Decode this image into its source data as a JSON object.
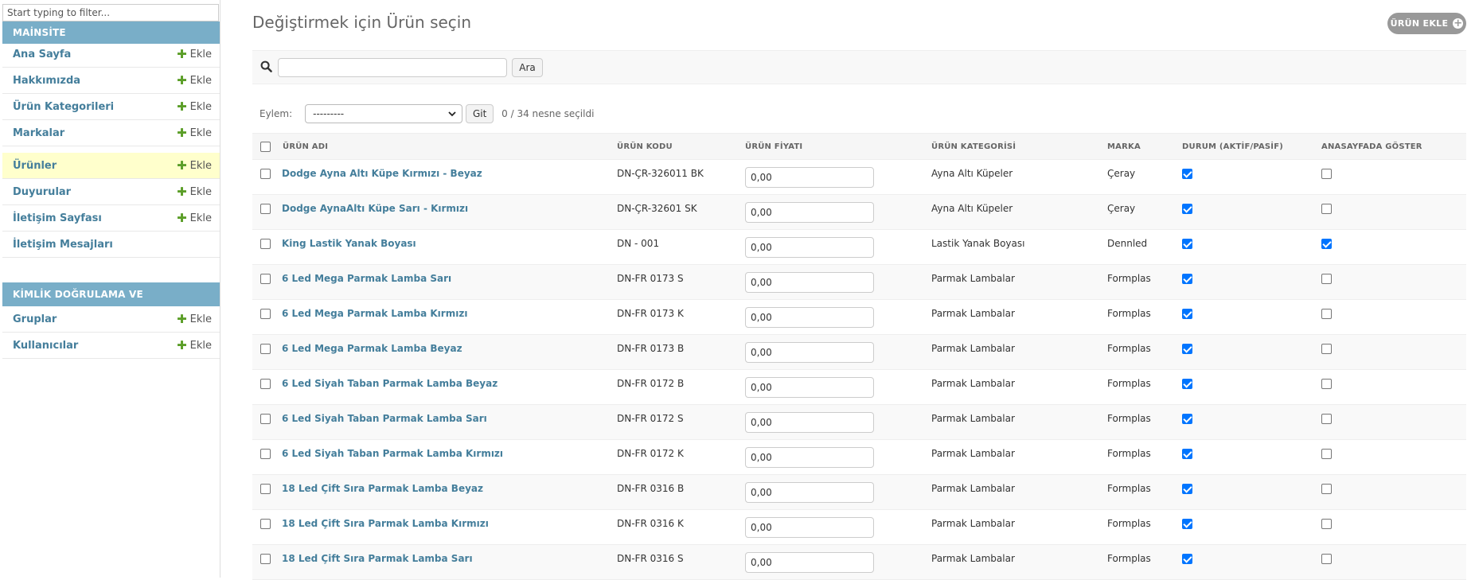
{
  "sidebar": {
    "filter_placeholder": "Start typing to filter...",
    "sections": [
      {
        "title": "MAİNSİTE",
        "items": [
          {
            "label": "Ana Sayfa",
            "add": "Ekle",
            "active": false
          },
          {
            "label": "Hakkımızda",
            "add": "Ekle",
            "active": false
          },
          {
            "label": "Ürün Kategorileri",
            "add": "Ekle",
            "active": false
          },
          {
            "label": "Markalar",
            "add": "Ekle",
            "active": false
          },
          {
            "label": "Ürünler",
            "add": "Ekle",
            "active": true
          },
          {
            "label": "Duyurular",
            "add": "Ekle",
            "active": false
          },
          {
            "label": "İletişim Sayfası",
            "add": "Ekle",
            "active": false
          },
          {
            "label": "İletişim Mesajları",
            "add": "",
            "active": false
          }
        ]
      },
      {
        "title": "KİMLİK DOĞRULAMA VE YETKİLENDİRME",
        "items": [
          {
            "label": "Gruplar",
            "add": "Ekle",
            "active": false
          },
          {
            "label": "Kullanıcılar",
            "add": "Ekle",
            "active": false
          }
        ]
      }
    ]
  },
  "main": {
    "title": "Değiştirmek için Ürün seçin",
    "add_button": "ÜRÜN EKLE",
    "search": {
      "value": "",
      "button": "Ara"
    },
    "actions": {
      "label": "Eylem:",
      "selected": "---------",
      "go": "Git",
      "counter": "0 / 34 nesne seçildi"
    },
    "columns": [
      "ÜRÜN ADI",
      "ÜRÜN KODU",
      "ÜRÜN FİYATI",
      "ÜRÜN KATEGORİSİ",
      "MARKA",
      "DURUM (AKTİF/PASİF)",
      "ANASAYFADA GÖSTER"
    ],
    "rows": [
      {
        "name": "Dodge Ayna Altı Küpe Kırmızı - Beyaz",
        "code": "DN-ÇR-326011 BK",
        "price": "0,00",
        "category": "Ayna Altı Küpeler",
        "brand": "Çeray",
        "active": true,
        "homepage": false
      },
      {
        "name": "Dodge AynaAltı Küpe Sarı - Kırmızı",
        "code": "DN-ÇR-32601 SK",
        "price": "0,00",
        "category": "Ayna Altı Küpeler",
        "brand": "Çeray",
        "active": true,
        "homepage": false
      },
      {
        "name": "King Lastik Yanak Boyası",
        "code": "DN - 001",
        "price": "0,00",
        "category": "Lastik Yanak Boyası",
        "brand": "Dennled",
        "active": true,
        "homepage": true
      },
      {
        "name": "6 Led Mega Parmak Lamba Sarı",
        "code": "DN-FR 0173 S",
        "price": "0,00",
        "category": "Parmak Lambalar",
        "brand": "Formplas",
        "active": true,
        "homepage": false
      },
      {
        "name": "6 Led Mega Parmak Lamba Kırmızı",
        "code": "DN-FR 0173 K",
        "price": "0,00",
        "category": "Parmak Lambalar",
        "brand": "Formplas",
        "active": true,
        "homepage": false
      },
      {
        "name": "6 Led Mega Parmak Lamba Beyaz",
        "code": "DN-FR 0173 B",
        "price": "0,00",
        "category": "Parmak Lambalar",
        "brand": "Formplas",
        "active": true,
        "homepage": false
      },
      {
        "name": "6 Led Siyah Taban Parmak Lamba Beyaz",
        "code": "DN-FR 0172 B",
        "price": "0,00",
        "category": "Parmak Lambalar",
        "brand": "Formplas",
        "active": true,
        "homepage": false
      },
      {
        "name": "6 Led Siyah Taban Parmak Lamba Sarı",
        "code": "DN-FR 0172 S",
        "price": "0,00",
        "category": "Parmak Lambalar",
        "brand": "Formplas",
        "active": true,
        "homepage": false
      },
      {
        "name": "6 Led Siyah Taban Parmak Lamba Kırmızı",
        "code": "DN-FR 0172 K",
        "price": "0,00",
        "category": "Parmak Lambalar",
        "brand": "Formplas",
        "active": true,
        "homepage": false
      },
      {
        "name": "18 Led Çift Sıra Parmak Lamba Beyaz",
        "code": "DN-FR 0316 B",
        "price": "0,00",
        "category": "Parmak Lambalar",
        "brand": "Formplas",
        "active": true,
        "homepage": false
      },
      {
        "name": "18 Led Çift Sıra Parmak Lamba Kırmızı",
        "code": "DN-FR 0316 K",
        "price": "0,00",
        "category": "Parmak Lambalar",
        "brand": "Formplas",
        "active": true,
        "homepage": false
      },
      {
        "name": "18 Led Çift Sıra Parmak Lamba Sarı",
        "code": "DN-FR 0316 S",
        "price": "0,00",
        "category": "Parmak Lambalar",
        "brand": "Formplas",
        "active": true,
        "homepage": false
      }
    ]
  },
  "colors": {
    "module_header": "#79aec8",
    "link": "#447e9b",
    "active_row": "#ffffcc",
    "add_plus": "#5b9e28",
    "checkbox_checked": "#0075ff"
  },
  "icons": {
    "search": "search-icon",
    "add": "plus-icon",
    "select": "chevron-down-icon"
  }
}
